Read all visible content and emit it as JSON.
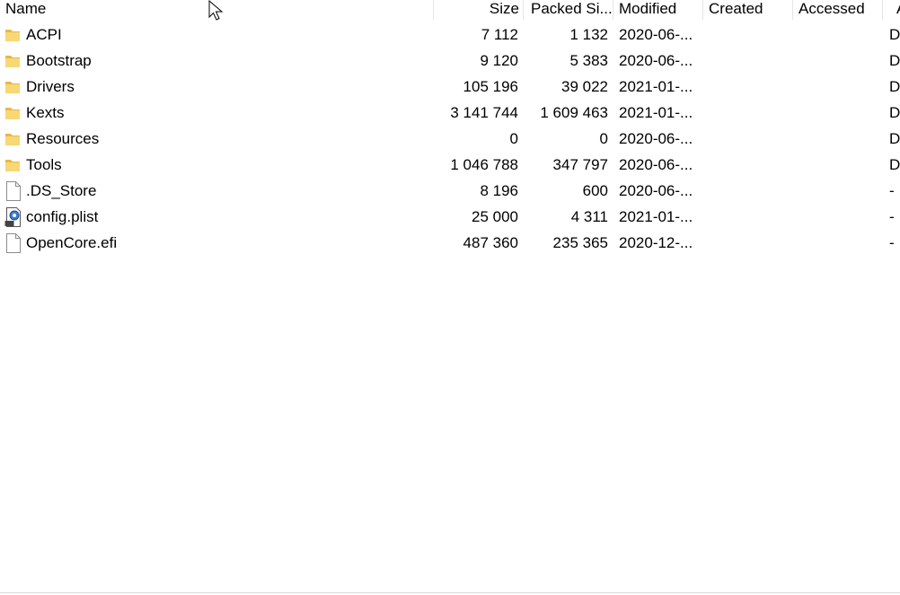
{
  "columns": {
    "name": "Name",
    "size": "Size",
    "packed": "Packed Si...",
    "modified": "Modified",
    "created": "Created",
    "accessed": "Accessed",
    "attributes": "A"
  },
  "rows": [
    {
      "icon": "folder-icon",
      "name": "ACPI",
      "size": "7 112",
      "packed": "1 132",
      "modified": "2020-06-...",
      "attr": "D"
    },
    {
      "icon": "folder-icon",
      "name": "Bootstrap",
      "size": "9 120",
      "packed": "5 383",
      "modified": "2020-06-...",
      "attr": "D"
    },
    {
      "icon": "folder-icon",
      "name": "Drivers",
      "size": "105 196",
      "packed": "39 022",
      "modified": "2021-01-...",
      "attr": "D"
    },
    {
      "icon": "folder-icon",
      "name": "Kexts",
      "size": "3 141 744",
      "packed": "1 609 463",
      "modified": "2021-01-...",
      "attr": "D"
    },
    {
      "icon": "folder-icon",
      "name": "Resources",
      "size": "0",
      "packed": "0",
      "modified": "2020-06-...",
      "attr": "D"
    },
    {
      "icon": "folder-icon",
      "name": "Tools",
      "size": "1 046 788",
      "packed": "347 797",
      "modified": "2020-06-...",
      "attr": "D"
    },
    {
      "icon": "file-icon",
      "name": ".DS_Store",
      "size": "8 196",
      "packed": "600",
      "modified": "2020-06-...",
      "attr": "-"
    },
    {
      "icon": "plist-file-icon",
      "name": "config.plist",
      "size": "25 000",
      "packed": "4 311",
      "modified": "2021-01-...",
      "attr": "-"
    },
    {
      "icon": "file-icon",
      "name": "OpenCore.efi",
      "size": "487 360",
      "packed": "235 365",
      "modified": "2020-12-...",
      "attr": "-"
    }
  ],
  "colors": {
    "folder_yellow": "#f8d775",
    "folder_dark": "#e8b84a",
    "separator": "#e5e5e5"
  }
}
